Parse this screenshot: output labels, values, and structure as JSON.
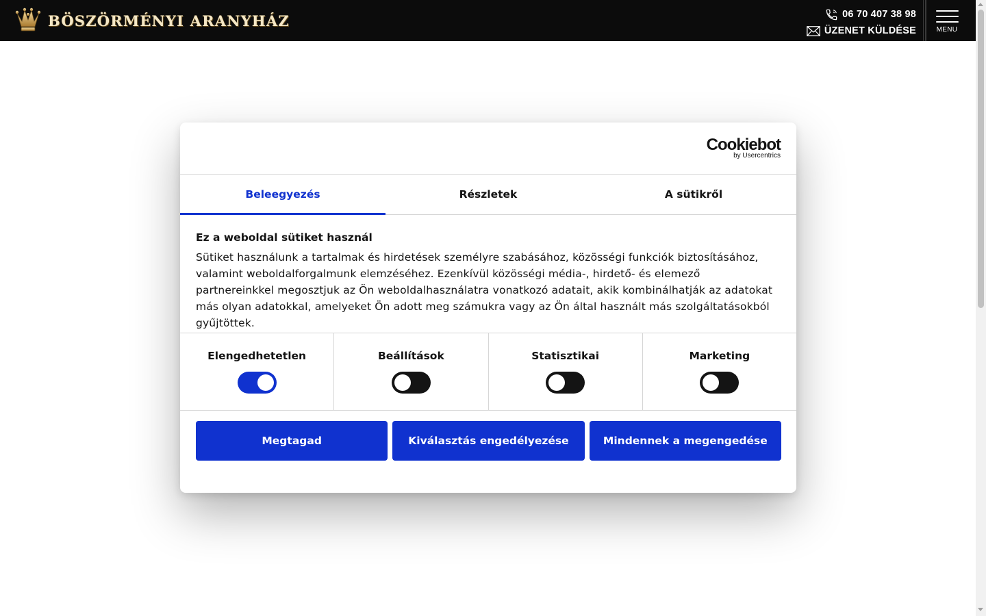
{
  "header": {
    "logo_text": "BÖSZÖRMÉNYI ARANYHÁZ",
    "phone": "06 70 407 38 98",
    "message": "ÜZENET KÜLDÉSE",
    "menu_label": "MENU"
  },
  "cookie_dialog": {
    "brand": "Cookiebot",
    "brand_sub": "by Usercentrics",
    "tabs": [
      {
        "label": "Beleegyezés",
        "active": true
      },
      {
        "label": "Részletek",
        "active": false
      },
      {
        "label": "A sütikről",
        "active": false
      }
    ],
    "title": "Ez a weboldal sütiket használ",
    "description": "Sütiket használunk a tartalmak és hirdetések személyre szabásához, közösségi funkciók biztosításához, valamint weboldalforgalmunk elemzéséhez. Ezenkívül közösségi média-, hirdető- és elemező partnereinkkel megosztjuk az Ön weboldalhasználatra vonatkozó adatait, akik kombinálhatják az adatokat más olyan adatokkal, amelyeket Ön adott meg számukra vagy az Ön által használt más szolgáltatásokból gyűjtöttek.",
    "categories": [
      {
        "label": "Elengedhetetlen",
        "enabled": true
      },
      {
        "label": "Beállítások",
        "enabled": false
      },
      {
        "label": "Statisztikai",
        "enabled": false
      },
      {
        "label": "Marketing",
        "enabled": false
      }
    ],
    "buttons": {
      "deny": "Megtagad",
      "allow_selection": "Kiválasztás engedélyezése",
      "allow_all": "Mindennek a megengedése"
    }
  },
  "colors": {
    "accent": "#1032cf",
    "header_bg": "#0c0c0c",
    "logo_gold": "#c9a45c"
  }
}
